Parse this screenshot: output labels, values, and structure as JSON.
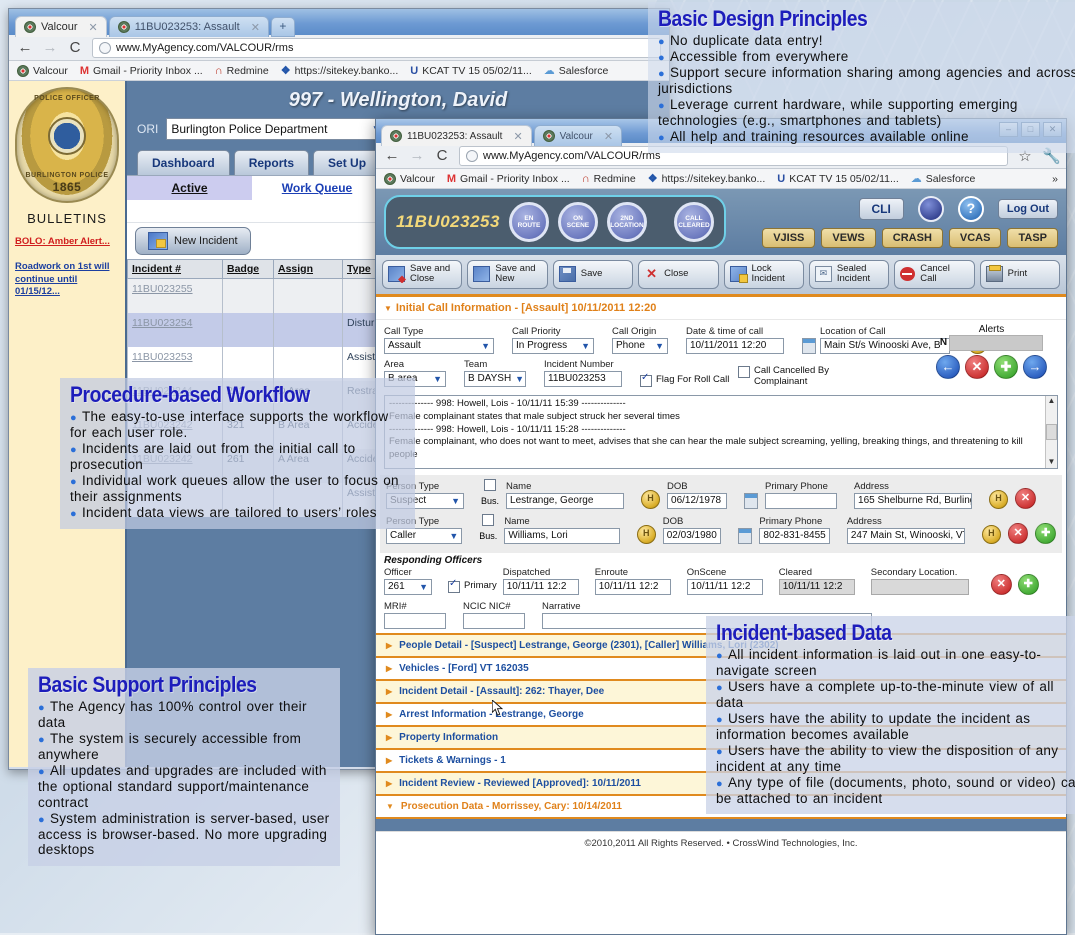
{
  "outer_browser": {
    "tabs": [
      {
        "label": "Valcour",
        "active": true
      },
      {
        "label": "11BU023253: Assault",
        "active": false
      }
    ],
    "newtab_label": "+",
    "nav": {
      "back": "←",
      "forward": "→",
      "reload": "C"
    },
    "url": "www.MyAgency.com/VALCOUR/rms",
    "bookmarks": [
      {
        "label": "Valcour",
        "icon": "valcour-icon"
      },
      {
        "label": "Gmail - Priority Inbox ...",
        "icon": "gmail-icon"
      },
      {
        "label": "Redmine",
        "icon": "redmine-icon"
      },
      {
        "label": "https://sitekey.banko...",
        "icon": "bank-icon"
      },
      {
        "label": "KCAT TV 15 05/02/11...",
        "icon": "kcat-icon"
      },
      {
        "label": "Salesforce",
        "icon": "salesforce-icon"
      }
    ]
  },
  "dashboard": {
    "user_header": "997 - Wellington, David",
    "ori_label": "ORI",
    "ori_value": "Burlington Police Department",
    "badge": {
      "top_text": "POLICE OFFICER",
      "bottom_text": "BURLINGTON POLICE",
      "year": "1865"
    },
    "bulletins_header": "BULLETINS",
    "bulletins": [
      "BOLO: Amber Alert...",
      "Roadwork on 1st will continue until 01/15/12..."
    ],
    "tabs": [
      "Dashboard",
      "Reports",
      "Set Up"
    ],
    "subtabs": [
      {
        "label": "Active",
        "selected": true
      },
      {
        "label": "Work Queue",
        "selected": false
      }
    ],
    "new_incident_label": "New Incident",
    "grid": {
      "columns": [
        "Incident #",
        "Badge",
        "Assign",
        "Type"
      ],
      "rows": [
        {
          "incident": "11BU023255",
          "badge": "",
          "assign": "",
          "type": ""
        },
        {
          "incident": "11BU023254",
          "badge": "",
          "assign": "",
          "type": "Disturbance"
        },
        {
          "incident": "11BU023253",
          "badge": "",
          "assign": "",
          "type": "Assist - Public"
        },
        {
          "incident": "11BU023244",
          "badge": "221",
          "assign": "D Area",
          "type": "Restraining Order Violation"
        },
        {
          "incident": "11BU023242",
          "badge": "321",
          "assign": "B Area",
          "type": "Accident - Prop damage only"
        },
        {
          "incident": "11BU023242",
          "badge": "261",
          "assign": "A Area",
          "type": "Accident - Prop damage only"
        },
        {
          "incident": "",
          "badge": "",
          "assign": "",
          "type": "Assist - Agency"
        }
      ]
    }
  },
  "inner_browser": {
    "tabs": [
      {
        "label": "11BU023253: Assault",
        "active": true
      },
      {
        "label": "Valcour",
        "active": false
      }
    ],
    "window_buttons": [
      "–",
      "□",
      "✕"
    ],
    "url": "www.MyAgency.com/VALCOUR/rms",
    "bookmarks": [
      {
        "label": "Valcour",
        "icon": "valcour-icon"
      },
      {
        "label": "Gmail - Priority Inbox ...",
        "icon": "gmail-icon"
      },
      {
        "label": "Redmine",
        "icon": "redmine-icon"
      },
      {
        "label": "https://sitekey.banko...",
        "icon": "bank-icon"
      },
      {
        "label": "KCAT TV 15 05/02/11...",
        "icon": "kcat-icon"
      },
      {
        "label": "Salesforce",
        "icon": "salesforce-icon"
      }
    ],
    "overflow": "»"
  },
  "incident": {
    "number": "11BU023253",
    "status_buttons": [
      "EN ROUTE",
      "ON SCENE",
      "2ND LOCATION",
      "CALL CLEARED"
    ],
    "cli_label": "CLI",
    "logout_label": "Log Out",
    "help_icon": "?",
    "gold_buttons": [
      "VJISS",
      "VEWS",
      "CRASH",
      "VCAS",
      "TASP"
    ],
    "actions": [
      {
        "label": "Save and Close",
        "icon": "save-close-icon"
      },
      {
        "label": "Save and New",
        "icon": "save-new-icon"
      },
      {
        "label": "Save",
        "icon": "save-icon"
      },
      {
        "label": "Close",
        "icon": "close-icon"
      },
      {
        "label": "Lock Incident",
        "icon": "lock-icon"
      },
      {
        "label": "Sealed Incident",
        "icon": "envelope-icon"
      },
      {
        "label": "Cancel Call",
        "icon": "cancel-icon"
      },
      {
        "label": "Print",
        "icon": "printer-icon"
      }
    ],
    "initial_call_header": "Initial Call Information - [Assault] 10/11/2011 12:20",
    "fields": {
      "call_type_label": "Call Type",
      "call_type_value": "Assault",
      "call_priority_label": "Call Priority",
      "call_priority_value": "In Progress",
      "call_origin_label": "Call Origin",
      "call_origin_value": "Phone",
      "datetime_label": "Date & time of call",
      "datetime_value": "10/11/2011 12:20",
      "location_label": "Location of Call",
      "location_value": "Main St/s Winooski Ave, B",
      "area_label": "Area",
      "area_value": "B area",
      "team_label": "Team",
      "team_value": "B DAYSH",
      "incident_number_label": "Incident Number",
      "incident_number_value": "11BU023253",
      "flag_for_roll_label": "Flag For Roll Call",
      "flag_for_roll_checked": true,
      "call_cancelled_label": "Call Cancelled By Complainant",
      "call_cancelled_checked": false
    },
    "alerts": {
      "label": "Alerts",
      "prefix": "N",
      "value": ""
    },
    "nav_icons": [
      "←",
      "✕",
      "✚",
      "→"
    ],
    "narrative_lines": [
      "-------------- 998: Howell, Lois - 10/11/11 15:39 --------------",
      "Female complainant states that male subject struck her several times",
      "-------------- 998: Howell, Lois - 10/11/11 15:28 --------------",
      "Female complainant, who does not want to meet, advises that she can hear the male subject screaming, yelling, breaking things, and threatening to kill people"
    ],
    "persons": {
      "labels": {
        "person_type": "Person Type",
        "bus": "Bus.",
        "name": "Name",
        "dob": "DOB",
        "phone": "Primary Phone",
        "address": "Address"
      },
      "rows": [
        {
          "type": "Suspect",
          "name": "Lestrange, George",
          "dob": "06/12/1978",
          "phone": "",
          "address": "165 Shelburne Rd, Burling"
        },
        {
          "type": "Caller",
          "name": "Williams, Lori",
          "dob": "02/03/1980",
          "phone": "802-831-8455",
          "address": "247 Main St, Winooski, VT"
        }
      ]
    },
    "responding_officers": {
      "header": "Responding Officers",
      "labels": {
        "officer": "Officer",
        "primary": "Primary",
        "dispatched": "Dispatched",
        "enroute": "Enroute",
        "onscene": "OnScene",
        "cleared": "Cleared",
        "secondary": "Secondary Location."
      },
      "row": {
        "officer": "261",
        "primary_checked": true,
        "dispatched": "10/11/11 12:2",
        "enroute": "10/11/11 12:2",
        "onscene": "10/11/11 12:2",
        "cleared": "10/11/11 12:2",
        "secondary": ""
      }
    },
    "mri": {
      "mri_label": "MRI#",
      "mri_value": "",
      "ncic_label": "NCIC NIC#",
      "ncic_value": "",
      "narrative_label": "Narrative",
      "narrative_value": ""
    },
    "accordion": [
      {
        "label": "People Detail - [Suspect] Lestrange, George (2301), [Caller] Williams, Lori (2302)",
        "expanded": false,
        "shade": "y"
      },
      {
        "label": "Vehicles - [Ford] VT 162035",
        "expanded": false,
        "shade": "w"
      },
      {
        "label": "Incident Detail - [Assault]: 262: Thayer, Dee",
        "expanded": false,
        "shade": "y"
      },
      {
        "label": "Arrest Information - Lestrange, George",
        "expanded": false,
        "shade": "w"
      },
      {
        "label": "Property Information",
        "expanded": false,
        "shade": "y"
      },
      {
        "label": "Tickets & Warnings - 1",
        "expanded": false,
        "shade": "w"
      },
      {
        "label": "Incident Review - Reviewed [Approved]: 10/11/2011",
        "expanded": false,
        "shade": "y"
      },
      {
        "label": "Prosecution Data - Morrissey, Cary: 10/14/2011",
        "expanded": true,
        "shade": "w"
      }
    ],
    "copyright": "©2010,2011 All Rights Reserved.  •  CrossWind Technologies, Inc."
  },
  "callouts": {
    "design": {
      "title": "Basic Design Principles",
      "bullets": [
        "No duplicate data entry!",
        "Accessible from everywhere",
        "Support secure information sharing among agencies and across jurisdictions",
        "Leverage current hardware, while supporting emerging technologies (e.g., smartphones and tablets)",
        "All help and training resources available online"
      ]
    },
    "workflow": {
      "title": "Procedure-based Workflow",
      "bullets": [
        "The easy-to-use interface supports the  workflow for each user role.",
        "Incidents are laid out from the initial call to prosecution",
        "Individual work queues allow the user to focus on their assignments",
        "Incident data views are tailored to users’ roles"
      ]
    },
    "support": {
      "title": "Basic Support Principles",
      "bullets": [
        "The Agency has 100% control over their data",
        "The system is securely accessible from anywhere",
        "All updates and upgrades are included with the optional standard support/maintenance contract",
        "System administration is server-based, user access is browser-based. No more upgrading desktops"
      ]
    },
    "incident_data": {
      "title": "Incident-based Data",
      "bullets": [
        "All incident information is laid out in one easy-to-navigate screen",
        "Users have a complete up-to-the-minute view of all data",
        "Users have the ability to update the incident as information becomes available",
        "Users have the ability to view the disposition of any incident at any time",
        "Any type of file (documents, photo, sound or video) can be attached to an incident"
      ]
    }
  }
}
